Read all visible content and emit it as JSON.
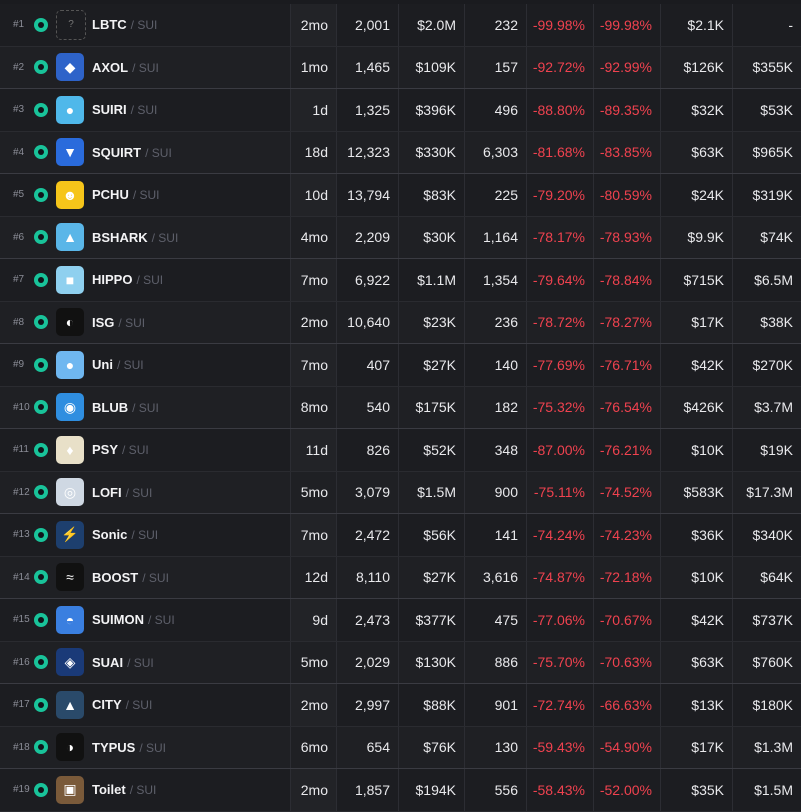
{
  "chain_label": "/ SUI",
  "colors": {
    "negative": "#f0424f",
    "chain_badge": "#19c39a"
  },
  "rows": [
    {
      "rank": "#1",
      "name": "LBTC",
      "logo": "?",
      "logo_bg": "transparent",
      "age": "2mo",
      "txns": "2,001",
      "volume": "$2.0M",
      "holders": "232",
      "change_a": "-99.98%",
      "change_b": "-99.98%",
      "liquidity": "$2.1K",
      "mcap": "-"
    },
    {
      "rank": "#2",
      "name": "AXOL",
      "logo": "◆",
      "logo_bg": "#2e63c9",
      "age": "1mo",
      "txns": "1,465",
      "volume": "$109K",
      "holders": "157",
      "change_a": "-92.72%",
      "change_b": "-92.99%",
      "liquidity": "$126K",
      "mcap": "$355K"
    },
    {
      "rank": "#3",
      "name": "SUIRI",
      "logo": "●",
      "logo_bg": "#4fb8ea",
      "age": "1d",
      "txns": "1,325",
      "volume": "$396K",
      "holders": "496",
      "change_a": "-88.80%",
      "change_b": "-89.35%",
      "liquidity": "$32K",
      "mcap": "$53K"
    },
    {
      "rank": "#4",
      "name": "SQUIRT",
      "logo": "▼",
      "logo_bg": "#2a6bdc",
      "age": "18d",
      "txns": "12,323",
      "volume": "$330K",
      "holders": "6,303",
      "change_a": "-81.68%",
      "change_b": "-83.85%",
      "liquidity": "$63K",
      "mcap": "$965K"
    },
    {
      "rank": "#5",
      "name": "PCHU",
      "logo": "☻",
      "logo_bg": "#f6c51a",
      "age": "10d",
      "txns": "13,794",
      "volume": "$83K",
      "holders": "225",
      "change_a": "-79.20%",
      "change_b": "-80.59%",
      "liquidity": "$24K",
      "mcap": "$319K"
    },
    {
      "rank": "#6",
      "name": "BSHARK",
      "logo": "▲",
      "logo_bg": "#5ab6e8",
      "age": "4mo",
      "txns": "2,209",
      "volume": "$30K",
      "holders": "1,164",
      "change_a": "-78.17%",
      "change_b": "-78.93%",
      "liquidity": "$9.9K",
      "mcap": "$74K"
    },
    {
      "rank": "#7",
      "name": "HIPPO",
      "logo": "■",
      "logo_bg": "#8fd0ef",
      "age": "7mo",
      "txns": "6,922",
      "volume": "$1.1M",
      "holders": "1,354",
      "change_a": "-79.64%",
      "change_b": "-78.84%",
      "liquidity": "$715K",
      "mcap": "$6.5M"
    },
    {
      "rank": "#8",
      "name": "ISG",
      "logo": "◐",
      "logo_bg": "#111",
      "age": "2mo",
      "txns": "10,640",
      "volume": "$23K",
      "holders": "236",
      "change_a": "-78.72%",
      "change_b": "-78.27%",
      "liquidity": "$17K",
      "mcap": "$38K"
    },
    {
      "rank": "#9",
      "name": "Uni",
      "logo": "●",
      "logo_bg": "#6fb7f0",
      "age": "7mo",
      "txns": "407",
      "volume": "$27K",
      "holders": "140",
      "change_a": "-77.69%",
      "change_b": "-76.71%",
      "liquidity": "$42K",
      "mcap": "$270K"
    },
    {
      "rank": "#10",
      "name": "BLUB",
      "logo": "◉",
      "logo_bg": "#2f8ee0",
      "age": "8mo",
      "txns": "540",
      "volume": "$175K",
      "holders": "182",
      "change_a": "-75.32%",
      "change_b": "-76.54%",
      "liquidity": "$426K",
      "mcap": "$3.7M"
    },
    {
      "rank": "#11",
      "name": "PSY",
      "logo": "♦",
      "logo_bg": "#e8e0c8",
      "age": "11d",
      "txns": "826",
      "volume": "$52K",
      "holders": "348",
      "change_a": "-87.00%",
      "change_b": "-76.21%",
      "liquidity": "$10K",
      "mcap": "$19K"
    },
    {
      "rank": "#12",
      "name": "LOFI",
      "logo": "◎",
      "logo_bg": "#cfd8e3",
      "age": "5mo",
      "txns": "3,079",
      "volume": "$1.5M",
      "holders": "900",
      "change_a": "-75.11%",
      "change_b": "-74.52%",
      "liquidity": "$583K",
      "mcap": "$17.3M"
    },
    {
      "rank": "#13",
      "name": "Sonic",
      "logo": "⚡",
      "logo_bg": "#1d3f6e",
      "age": "7mo",
      "txns": "2,472",
      "volume": "$56K",
      "holders": "141",
      "change_a": "-74.24%",
      "change_b": "-74.23%",
      "liquidity": "$36K",
      "mcap": "$340K"
    },
    {
      "rank": "#14",
      "name": "BOOST",
      "logo": "≈",
      "logo_bg": "#111",
      "age": "12d",
      "txns": "8,110",
      "volume": "$27K",
      "holders": "3,616",
      "change_a": "-74.87%",
      "change_b": "-72.18%",
      "liquidity": "$10K",
      "mcap": "$64K"
    },
    {
      "rank": "#15",
      "name": "SUIMON",
      "logo": "◓",
      "logo_bg": "#3a7fe0",
      "age": "9d",
      "txns": "2,473",
      "volume": "$377K",
      "holders": "475",
      "change_a": "-77.06%",
      "change_b": "-70.67%",
      "liquidity": "$42K",
      "mcap": "$737K"
    },
    {
      "rank": "#16",
      "name": "SUAI",
      "logo": "◈",
      "logo_bg": "#1a3a78",
      "age": "5mo",
      "txns": "2,029",
      "volume": "$130K",
      "holders": "886",
      "change_a": "-75.70%",
      "change_b": "-70.63%",
      "liquidity": "$63K",
      "mcap": "$760K"
    },
    {
      "rank": "#17",
      "name": "CITY",
      "logo": "▲",
      "logo_bg": "#2a4a6a",
      "age": "2mo",
      "txns": "2,997",
      "volume": "$88K",
      "holders": "901",
      "change_a": "-72.74%",
      "change_b": "-66.63%",
      "liquidity": "$13K",
      "mcap": "$180K"
    },
    {
      "rank": "#18",
      "name": "TYPUS",
      "logo": "◑",
      "logo_bg": "#111",
      "age": "6mo",
      "txns": "654",
      "volume": "$76K",
      "holders": "130",
      "change_a": "-59.43%",
      "change_b": "-54.90%",
      "liquidity": "$17K",
      "mcap": "$1.3M"
    },
    {
      "rank": "#19",
      "name": "Toilet",
      "logo": "▣",
      "logo_bg": "#7a5a3a",
      "age": "2mo",
      "txns": "1,857",
      "volume": "$194K",
      "holders": "556",
      "change_a": "-58.43%",
      "change_b": "-52.00%",
      "liquidity": "$35K",
      "mcap": "$1.5M"
    }
  ]
}
